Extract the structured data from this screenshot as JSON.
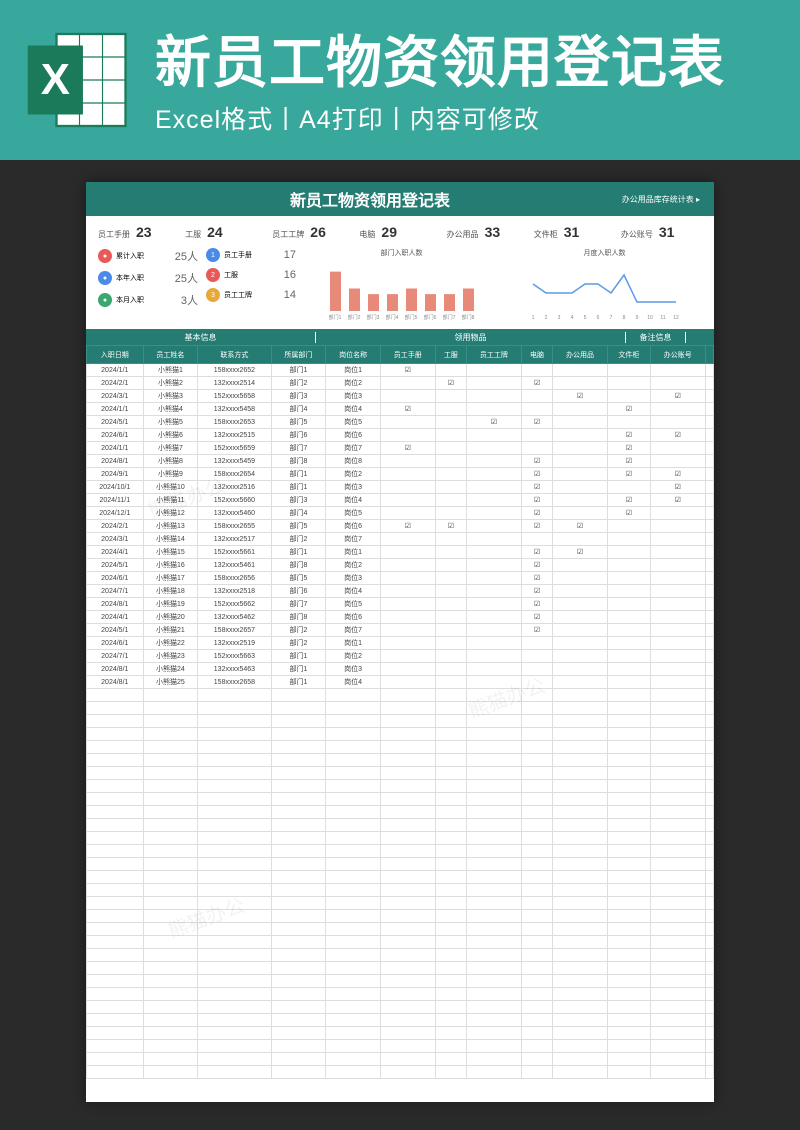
{
  "hero": {
    "title": "新员工物资领用登记表",
    "subtitle": "Excel格式丨A4打印丨内容可修改"
  },
  "sheet": {
    "title": "新员工物资领用登记表",
    "link": "办公用品库存统计表 ▸",
    "topStats": [
      {
        "label": "员工手册",
        "value": "23"
      },
      {
        "label": "工服",
        "value": "24"
      },
      {
        "label": "员工工牌",
        "value": "26"
      },
      {
        "label": "电脑",
        "value": "29"
      },
      {
        "label": "办公用品",
        "value": "33"
      },
      {
        "label": "文件柜",
        "value": "31"
      },
      {
        "label": "办公账号",
        "value": "31"
      }
    ],
    "leftMetrics": [
      {
        "icon": "d-red",
        "label": "累计入职",
        "value": "25人"
      },
      {
        "icon": "d-blue",
        "label": "本年入职",
        "value": "25人"
      },
      {
        "icon": "d-green",
        "label": "本月入职",
        "value": "3人"
      }
    ],
    "midMetrics": [
      {
        "icon": "d-blue",
        "num": "1",
        "label": "员工手册",
        "value": "17"
      },
      {
        "icon": "d-red",
        "num": "2",
        "label": "工服",
        "value": "16"
      },
      {
        "icon": "d-orange",
        "num": "3",
        "label": "员工工牌",
        "value": "14"
      }
    ],
    "chart1": {
      "title": "部门入职人数",
      "labels": [
        "部门1",
        "部门2",
        "部门3",
        "部门4",
        "部门5",
        "部门6",
        "部门7",
        "部门8"
      ]
    },
    "chart2": {
      "title": "月度入职人数",
      "labels": [
        "1",
        "2",
        "3",
        "4",
        "5",
        "6",
        "7",
        "8",
        "9",
        "10",
        "11",
        "12"
      ]
    },
    "groups": [
      {
        "label": "基本信息",
        "width": "230"
      },
      {
        "label": "领用物品",
        "width": "310"
      },
      {
        "label": "备注信息",
        "width": "60"
      }
    ],
    "headers": [
      "入职日期",
      "员工姓名",
      "联系方式",
      "所属部门",
      "岗位名称",
      "员工手册",
      "工服",
      "员工工牌",
      "电脑",
      "办公用品",
      "文件柜",
      "办公账号",
      ""
    ],
    "rows": [
      [
        "2024/1/1",
        "小熊猫1",
        "158xxxx2652",
        "部门1",
        "岗位1",
        "☑",
        "",
        "",
        "",
        "",
        "",
        ""
      ],
      [
        "2024/2/1",
        "小熊猫2",
        "132xxxx2514",
        "部门2",
        "岗位2",
        "",
        "☑",
        "",
        "☑",
        "",
        "",
        ""
      ],
      [
        "2024/3/1",
        "小熊猫3",
        "152xxxx5658",
        "部门3",
        "岗位3",
        "",
        "",
        "",
        "",
        "☑",
        "",
        "☑"
      ],
      [
        "2024/1/1",
        "小熊猫4",
        "132xxxx5458",
        "部门4",
        "岗位4",
        "☑",
        "",
        "",
        "",
        "",
        "☑",
        ""
      ],
      [
        "2024/5/1",
        "小熊猫5",
        "158xxxx2653",
        "部门5",
        "岗位5",
        "",
        "",
        "☑",
        "☑",
        "",
        "",
        ""
      ],
      [
        "2024/6/1",
        "小熊猫6",
        "132xxxx2515",
        "部门6",
        "岗位6",
        "",
        "",
        "",
        "",
        "",
        "☑",
        "☑"
      ],
      [
        "2024/1/1",
        "小熊猫7",
        "152xxxx5659",
        "部门7",
        "岗位7",
        "☑",
        "",
        "",
        "",
        "",
        "☑",
        ""
      ],
      [
        "2024/8/1",
        "小熊猫8",
        "132xxxx5459",
        "部门8",
        "岗位8",
        "",
        "",
        "",
        "☑",
        "",
        "☑",
        ""
      ],
      [
        "2024/9/1",
        "小熊猫9",
        "158xxxx2654",
        "部门1",
        "岗位2",
        "",
        "",
        "",
        "☑",
        "",
        "☑",
        "☑"
      ],
      [
        "2024/10/1",
        "小熊猫10",
        "132xxxx2516",
        "部门1",
        "岗位3",
        "",
        "",
        "",
        "☑",
        "",
        "",
        "☑"
      ],
      [
        "2024/11/1",
        "小熊猫11",
        "152xxxx5660",
        "部门3",
        "岗位4",
        "",
        "",
        "",
        "☑",
        "",
        "☑",
        "☑"
      ],
      [
        "2024/12/1",
        "小熊猫12",
        "132xxxx5460",
        "部门4",
        "岗位5",
        "",
        "",
        "",
        "☑",
        "",
        "☑",
        ""
      ],
      [
        "2024/2/1",
        "小熊猫13",
        "158xxxx2655",
        "部门5",
        "岗位6",
        "☑",
        "☑",
        "",
        "☑",
        "☑",
        "",
        ""
      ],
      [
        "2024/3/1",
        "小熊猫14",
        "132xxxx2517",
        "部门2",
        "岗位7",
        "",
        "",
        "",
        "",
        "",
        "",
        ""
      ],
      [
        "2024/4/1",
        "小熊猫15",
        "152xxxx5661",
        "部门1",
        "岗位1",
        "",
        "",
        "",
        "☑",
        "☑",
        "",
        ""
      ],
      [
        "2024/5/1",
        "小熊猫16",
        "132xxxx5461",
        "部门8",
        "岗位2",
        "",
        "",
        "",
        "☑",
        "",
        "",
        ""
      ],
      [
        "2024/6/1",
        "小熊猫17",
        "158xxxx2656",
        "部门5",
        "岗位3",
        "",
        "",
        "",
        "☑",
        "",
        "",
        ""
      ],
      [
        "2024/7/1",
        "小熊猫18",
        "132xxxx2518",
        "部门6",
        "岗位4",
        "",
        "",
        "",
        "☑",
        "",
        "",
        ""
      ],
      [
        "2024/8/1",
        "小熊猫19",
        "152xxxx5662",
        "部门7",
        "岗位5",
        "",
        "",
        "",
        "☑",
        "",
        "",
        ""
      ],
      [
        "2024/4/1",
        "小熊猫20",
        "132xxxx5462",
        "部门8",
        "岗位6",
        "",
        "",
        "",
        "☑",
        "",
        "",
        ""
      ],
      [
        "2024/5/1",
        "小熊猫21",
        "158xxxx2657",
        "部门2",
        "岗位7",
        "",
        "",
        "",
        "☑",
        "",
        "",
        ""
      ],
      [
        "2024/6/1",
        "小熊猫22",
        "132xxxx2519",
        "部门2",
        "岗位1",
        "",
        "",
        "",
        "",
        "",
        "",
        ""
      ],
      [
        "2024/7/1",
        "小熊猫23",
        "152xxxx5663",
        "部门1",
        "岗位2",
        "",
        "",
        "",
        "",
        "",
        "",
        ""
      ],
      [
        "2024/8/1",
        "小熊猫24",
        "132xxxx5463",
        "部门1",
        "岗位3",
        "",
        "",
        "",
        "",
        "",
        "",
        ""
      ],
      [
        "2024/8/1",
        "小熊猫25",
        "158xxxx2658",
        "部门1",
        "岗位4",
        "",
        "",
        "",
        "",
        "",
        "",
        ""
      ]
    ],
    "emptyRows": 30
  },
  "chart_data": [
    {
      "type": "bar",
      "title": "部门入职人数",
      "categories": [
        "部门1",
        "部门2",
        "部门3",
        "部门4",
        "部门5",
        "部门6",
        "部门7",
        "部门8"
      ],
      "values": [
        7,
        4,
        3,
        3,
        4,
        3,
        3,
        4
      ],
      "ylim": [
        0,
        8
      ]
    },
    {
      "type": "line",
      "title": "月度入职人数",
      "categories": [
        "1",
        "2",
        "3",
        "4",
        "5",
        "6",
        "7",
        "8",
        "9",
        "10",
        "11",
        "12"
      ],
      "values": [
        3,
        2,
        2,
        2,
        3,
        3,
        2,
        4,
        1,
        1,
        1,
        1
      ],
      "ylim": [
        0,
        5
      ]
    }
  ],
  "watermark": "熊猫办公"
}
